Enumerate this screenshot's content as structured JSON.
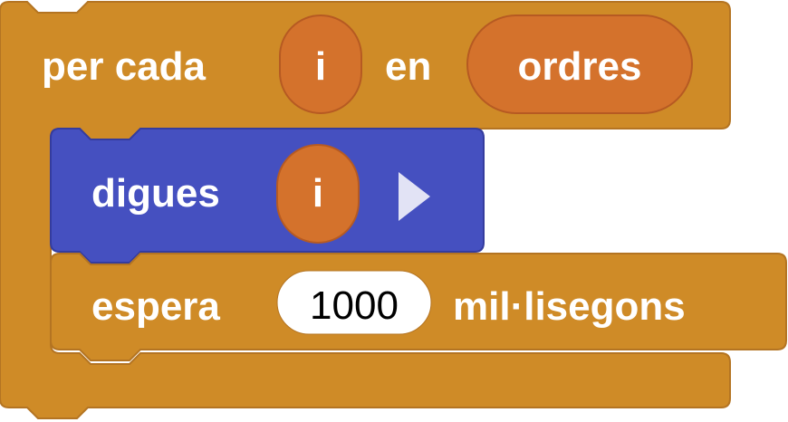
{
  "colors": {
    "control": "#CF8B27",
    "control_border": "#B47422",
    "variable": "#D4722C",
    "variable_border": "#B65A22",
    "looks": "#4550C0",
    "looks_border": "#343C9E",
    "input_bg": "#FFFFFF",
    "text": "#FFFFFF",
    "number_text": "#000000",
    "arrow": "#E2E3F5"
  },
  "for_each_block": {
    "label_prefix": "per cada",
    "item_variable": "i",
    "label_middle": "en",
    "list_variable": "ordres"
  },
  "say_block": {
    "label": "digues",
    "argument_variable": "i",
    "expand_icon": "triangle-right-icon"
  },
  "wait_block": {
    "label_prefix": "espera",
    "value": "1000",
    "label_suffix": "mil·lisegons"
  }
}
